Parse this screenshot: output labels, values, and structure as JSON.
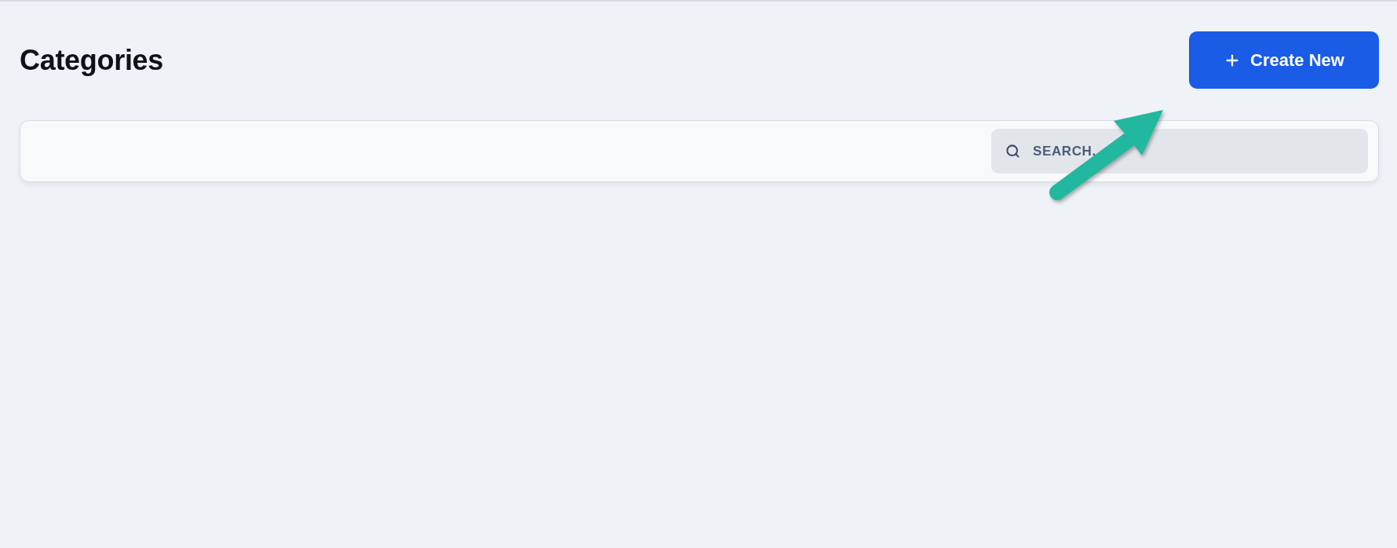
{
  "header": {
    "title": "Categories",
    "create_button": {
      "label": "Create New"
    }
  },
  "toolbar": {
    "search": {
      "placeholder": "SEARCH."
    }
  }
}
